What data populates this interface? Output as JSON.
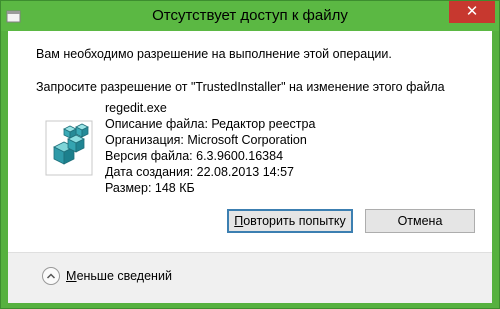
{
  "window": {
    "title": "Отсутствует доступ к файлу",
    "close_label": "✕"
  },
  "message": {
    "line1": "Вам необходимо разрешение на выполнение этой операции.",
    "line2": "Запросите разрешение от \"TrustedInstaller\" на изменение этого файла"
  },
  "file": {
    "icon": "registry-editor-icon",
    "name": "regedit.exe",
    "description": "Описание файла: Редактор реестра",
    "organization": "Организация: Microsoft Corporation",
    "version": "Версия файла: 6.3.9600.16384",
    "created": "Дата создания: 22.08.2013 14:57",
    "size": "Размер: 148 КБ"
  },
  "buttons": {
    "retry": {
      "first_letter": "П",
      "rest": "овторить попытку"
    },
    "cancel": "Отмена"
  },
  "details": {
    "toggle_label": {
      "first_letter": "М",
      "rest": "еньше сведений"
    }
  },
  "colors": {
    "titlebar": "#5bb843",
    "close_button": "#c7382f",
    "default_button_border": "#3c7fb1"
  }
}
